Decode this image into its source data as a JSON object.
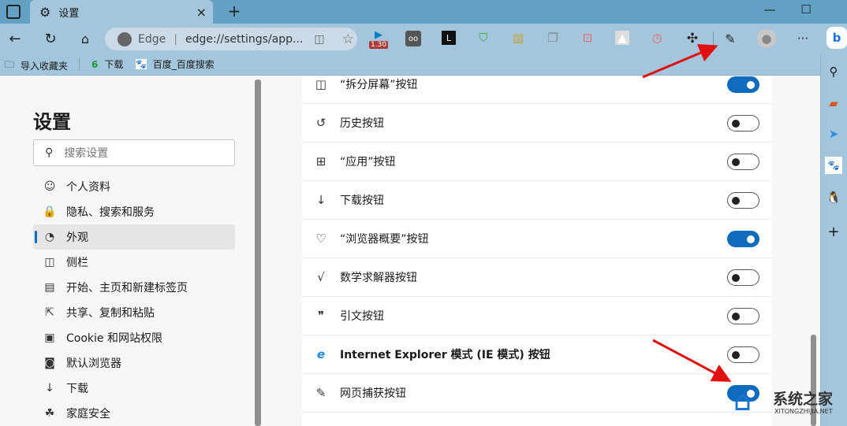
{
  "tab": {
    "title": "设置",
    "close": "×",
    "new_tab": "+"
  },
  "window": {
    "minimize": "—",
    "maximize": "☐"
  },
  "address": {
    "brand": "Edge",
    "url": "edge://settings/app..."
  },
  "extension_badge": "1.30",
  "bookmarks": [
    {
      "icon": "6",
      "label": "下载"
    },
    {
      "icon": "🐾",
      "label": "百度_百度搜索"
    }
  ],
  "import_favorites": "导入收藏夹",
  "settings": {
    "title": "设置",
    "search_placeholder": "搜索设置",
    "nav": [
      {
        "label": "个人资料",
        "icon": "profile-icon",
        "glyph": "☺"
      },
      {
        "label": "隐私、搜索和服务",
        "icon": "lock-icon",
        "glyph": "🔒"
      },
      {
        "label": "外观",
        "icon": "palette-icon",
        "glyph": "◔",
        "active": true
      },
      {
        "label": "侧栏",
        "icon": "sidebar-icon",
        "glyph": "◫"
      },
      {
        "label": "开始、主页和新建标签页",
        "icon": "home-tab-icon",
        "glyph": "▤"
      },
      {
        "label": "共享、复制和粘贴",
        "icon": "share-icon",
        "glyph": "⇱"
      },
      {
        "label": "Cookie 和网站权限",
        "icon": "cookie-icon",
        "glyph": "▣"
      },
      {
        "label": "默认浏览器",
        "icon": "browser-icon",
        "glyph": "◙"
      },
      {
        "label": "下载",
        "icon": "download-icon",
        "glyph": "↓"
      },
      {
        "label": "家庭安全",
        "icon": "family-icon",
        "glyph": "☘"
      }
    ]
  },
  "toolbar_buttons": [
    {
      "label": "“拆分屏幕”按钮",
      "icon": "split-screen-icon",
      "glyph": "◫",
      "on": true
    },
    {
      "label": "历史按钮",
      "icon": "history-icon",
      "glyph": "↺",
      "on": false
    },
    {
      "label": "“应用”按钮",
      "icon": "apps-icon",
      "glyph": "⊞",
      "on": false
    },
    {
      "label": "下载按钮",
      "icon": "download-icon",
      "glyph": "↓",
      "on": false
    },
    {
      "label": "“浏览器概要”按钮",
      "icon": "heartbeat-icon",
      "glyph": "♡",
      "on": true
    },
    {
      "label": "数学求解器按钮",
      "icon": "math-solver-icon",
      "glyph": "√",
      "on": false
    },
    {
      "label": "引文按钮",
      "icon": "quote-icon",
      "glyph": "❞",
      "on": false
    },
    {
      "label": "Internet Explorer 模式 (IE 模式) 按钮",
      "icon": "ie-icon",
      "glyph": "e",
      "on": false
    },
    {
      "label": "网页捕获按钮",
      "icon": "web-capture-icon",
      "glyph": "✎",
      "on": true
    }
  ],
  "watermark": {
    "name": "系统之家",
    "url": "XITONGZHIJIA.NET"
  },
  "colors": {
    "accent": "#0f6cbd",
    "frame": "#a4c6dc",
    "arrow": "#e01010"
  }
}
